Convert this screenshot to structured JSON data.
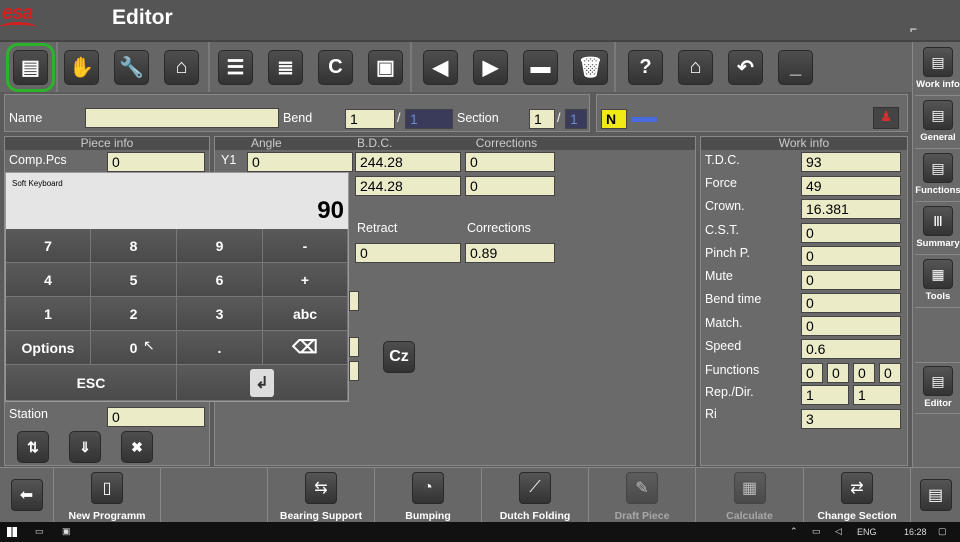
{
  "app": {
    "logo": "esa",
    "title": "Editor"
  },
  "toolbar": {
    "icons": [
      "document-icon",
      "hand-icon",
      "wrench-icon",
      "factory-icon",
      "stack-icon",
      "stack-down-icon",
      "c-icon",
      "save-icon",
      "left-arrow-icon",
      "right-arrow-icon",
      "minus-icon",
      "trash-icon",
      "help-icon",
      "home-icon",
      "undo-icon",
      "dash-icon"
    ]
  },
  "sidebar": {
    "items": [
      {
        "label": "Work info",
        "icon": "work-info-icon"
      },
      {
        "label": "General",
        "icon": "general-icon"
      },
      {
        "label": "Functions",
        "icon": "functions-icon"
      },
      {
        "label": "Summary",
        "icon": "summary-icon"
      },
      {
        "label": "Tools",
        "icon": "tools-icon"
      },
      {
        "label": "Editor",
        "icon": "editor-icon"
      }
    ]
  },
  "namebar": {
    "name_label": "Name",
    "name_value": "",
    "bend_label": "Bend",
    "bend_value": "1",
    "bend_sep": "/",
    "bend_total": "1",
    "section_label": "Section",
    "section_value": "1",
    "section_sep": "/",
    "section_total": "1",
    "n_label": "N"
  },
  "piece_info": {
    "header": "Piece info",
    "comp_label": "Comp.Pcs",
    "comp_value": "0",
    "station_label": "Station",
    "station_value": "0"
  },
  "bend_panel": {
    "angle_header": "Angle",
    "bdc_header": "B.D.C.",
    "corr_header": "Corrections",
    "y1_label": "Y1",
    "y1_angle": "0",
    "y1_bdc": "244.28",
    "y1_corr": "0",
    "y2_bdc": "244.28",
    "y2_corr": "0",
    "retract_label": "Retract",
    "corrections_label": "Corrections",
    "retract_value": "0",
    "corrections_value": "0.89"
  },
  "work_info": {
    "header": "Work info",
    "rows": [
      {
        "label": "T.D.C.",
        "value": "93"
      },
      {
        "label": "Force",
        "value": "49"
      },
      {
        "label": "Crown.",
        "value": "16.381"
      },
      {
        "label": "C.S.T.",
        "value": "0"
      },
      {
        "label": "Pinch P.",
        "value": "0"
      },
      {
        "label": "Mute",
        "value": "0"
      },
      {
        "label": "Bend time",
        "value": "0"
      },
      {
        "label": "Match.",
        "value": "0"
      },
      {
        "label": "Speed",
        "value": "0.6"
      }
    ],
    "functions_label": "Functions",
    "functions_values": [
      "0",
      "0",
      "0",
      "0"
    ],
    "rep_label": "Rep./Dir.",
    "rep_values": [
      "1",
      "1"
    ],
    "ri_label": "Ri",
    "ri_value": "3"
  },
  "keyboard": {
    "title": "Soft Keyboard",
    "value": "90",
    "keys": [
      "7",
      "8",
      "9",
      "-",
      "4",
      "5",
      "6",
      "+",
      "1",
      "2",
      "3",
      "abc",
      "Options",
      "0",
      ".",
      "⌫"
    ],
    "esc": "ESC",
    "enter": "↲"
  },
  "bottom": {
    "items": [
      {
        "label": "",
        "icon": "back-arrow-icon"
      },
      {
        "label": "New Programm",
        "icon": "new-doc-icon"
      },
      {
        "label": "",
        "icon": ""
      },
      {
        "label": "Bearing Support",
        "icon": "bearing-icon"
      },
      {
        "label": "Bumping",
        "icon": "bumping-icon"
      },
      {
        "label": "Dutch Folding",
        "icon": "dutch-folding-icon"
      },
      {
        "label": "Draft Piece",
        "icon": "draft-icon"
      },
      {
        "label": "Calculate",
        "icon": "calculate-icon"
      },
      {
        "label": "Change Section",
        "icon": "change-section-icon"
      },
      {
        "label": "",
        "icon": "menu-icon"
      }
    ]
  },
  "taskbar": {
    "lang": "ENG",
    "time": "16:28"
  }
}
